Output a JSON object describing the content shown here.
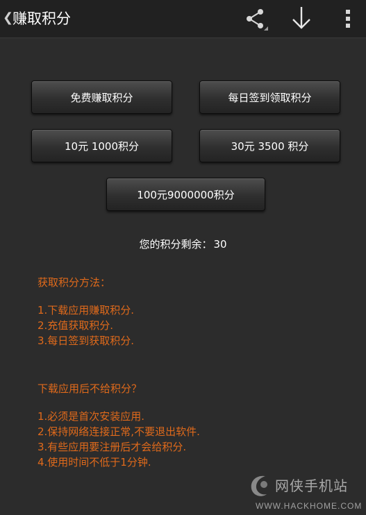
{
  "header": {
    "title": "赚取积分",
    "back_glyph": "❮",
    "icons": [
      "back-icon",
      "share-icon",
      "download-icon",
      "overflow-menu-icon"
    ]
  },
  "buttons": [
    {
      "label": "免费赚取积分"
    },
    {
      "label": "每日签到领取积分"
    },
    {
      "label": "10元 1000积分"
    },
    {
      "label": "30元 3500 积分"
    },
    {
      "label": "100元9000000积分"
    }
  ],
  "points": {
    "label": "您的积分剩余：",
    "value": "30"
  },
  "methods": {
    "title": "获取积分方法：",
    "items": [
      "1.下载应用赚取积分.",
      "2.充值获取积分.",
      "3.每日签到获取积分."
    ]
  },
  "faq": {
    "title": "下载应用后不给积分？",
    "items": [
      "1.必须是首次安装应用.",
      "2.保持网络连接正常,不要退出软件.",
      "3.有些应用要注册后才会给积分.",
      "4.使用时间不低于1分钟."
    ]
  },
  "watermark": {
    "name": "网侠手机站",
    "url": "WWW.HACKHOME.COM"
  },
  "colors": {
    "background": "#2c2c2c",
    "action_bar": "#212121",
    "accent_orange": "#e06a1b",
    "text": "#ffffff"
  }
}
